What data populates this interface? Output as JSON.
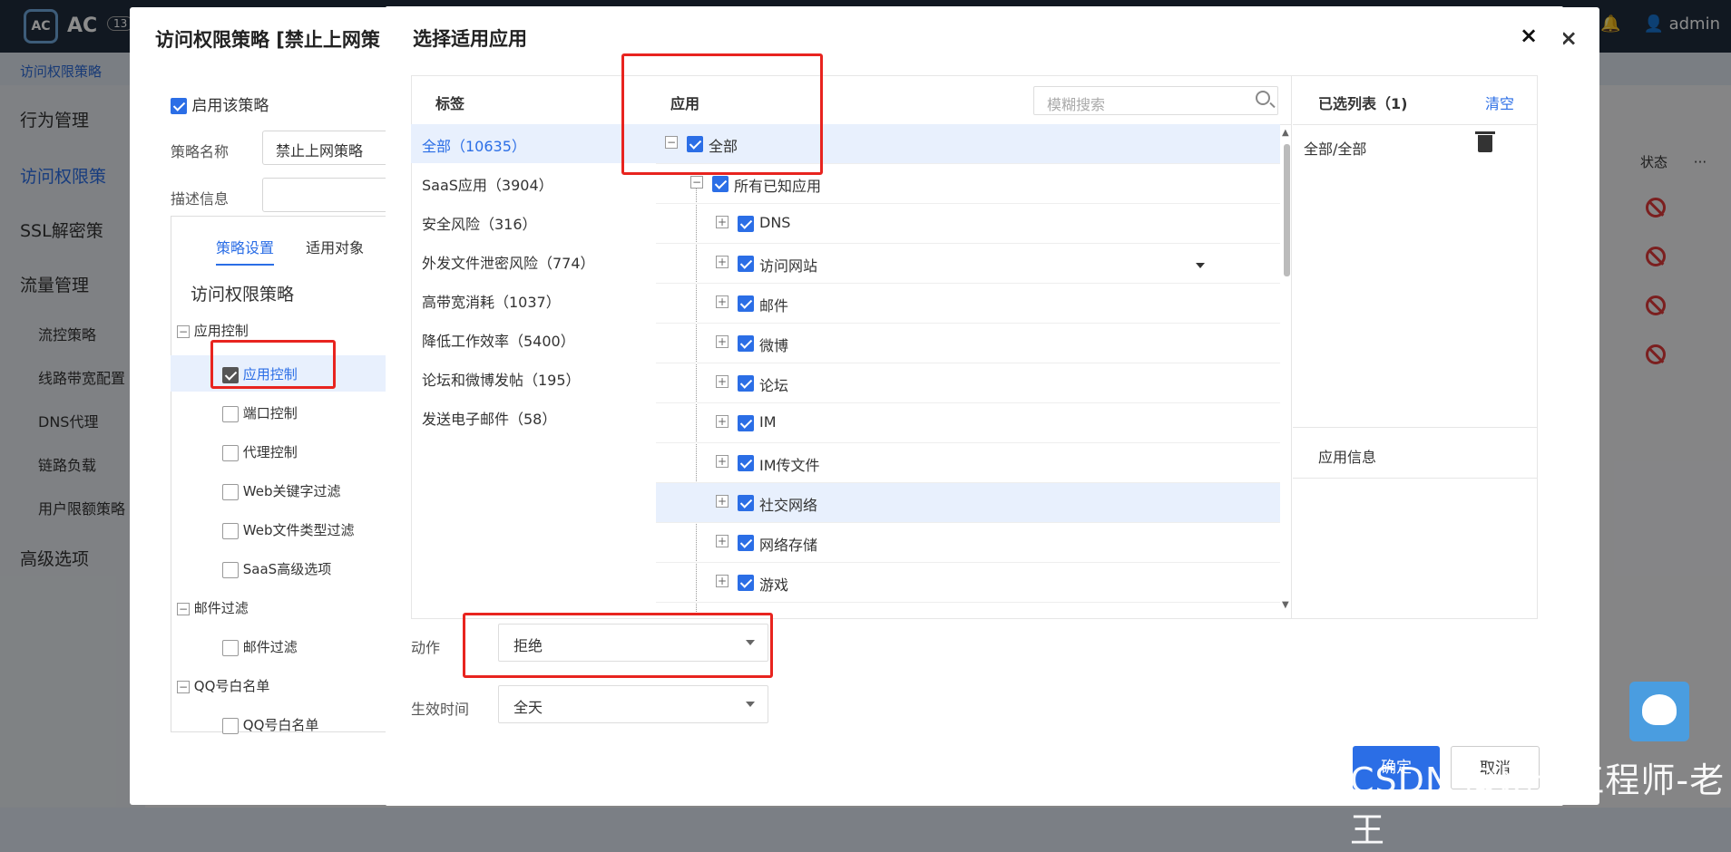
{
  "app": {
    "logo_text": "AC",
    "version_badge": "13",
    "user": "admin"
  },
  "breadcrumb": "访问权限策略",
  "sidenav": {
    "items": [
      "行为管理",
      "访问权限策",
      "SSL解密策",
      "流量管理",
      "高级选项"
    ],
    "subitems": [
      "流控策略",
      "线路带宽配置",
      "DNS代理",
      "链路负载",
      "用户限额策略"
    ]
  },
  "bg_table": {
    "status_header": "状态",
    "more": "···"
  },
  "policy_dialog": {
    "title": "访问权限策略 [禁止上网策",
    "enable_label": "启用该策略",
    "name_label": "策略名称",
    "name_value": "禁止上网策略",
    "desc_label": "描述信息",
    "tabs": [
      "策略设置",
      "适用对象"
    ],
    "section_title": "访问权限策略",
    "tree": [
      {
        "label": "应用控制",
        "group": true
      },
      {
        "label": "应用控制",
        "checked": true
      },
      {
        "label": "端口控制"
      },
      {
        "label": "代理控制"
      },
      {
        "label": "Web关键字过滤"
      },
      {
        "label": "Web文件类型过滤"
      },
      {
        "label": "SaaS高级选项"
      },
      {
        "label": "邮件过滤",
        "group": true
      },
      {
        "label": "邮件过滤"
      },
      {
        "label": "QQ号白名单",
        "group": true
      },
      {
        "label": "QQ号白名单"
      }
    ]
  },
  "app_dialog": {
    "title": "选择适用应用",
    "close": "×",
    "tag_header": "标签",
    "app_header": "应用",
    "search_placeholder": "模糊搜索",
    "tags": [
      "全部（10635）",
      "SaaS应用（3904）",
      "安全风险（316）",
      "外发文件泄密风险（774）",
      "高带宽消耗（1037）",
      "降低工作效率（5400）",
      "论坛和微博发帖（195）",
      "发送电子邮件（58）"
    ],
    "apps": [
      {
        "label": "全部",
        "level": 0
      },
      {
        "label": "所有已知应用",
        "level": 1
      },
      {
        "label": "DNS",
        "level": 2
      },
      {
        "label": "访问网站",
        "level": 2
      },
      {
        "label": "邮件",
        "level": 2
      },
      {
        "label": "微博",
        "level": 2
      },
      {
        "label": "论坛",
        "level": 2
      },
      {
        "label": "IM",
        "level": 2
      },
      {
        "label": "IM传文件",
        "level": 2
      },
      {
        "label": "社交网络",
        "level": 2
      },
      {
        "label": "网络存储",
        "level": 2
      },
      {
        "label": "游戏",
        "level": 2
      }
    ],
    "selected_header": "已选列表（1)",
    "clear": "清空",
    "selected_items": [
      "全部/全部"
    ],
    "app_info": "应用信息",
    "action_label": "动作",
    "action_value": "拒绝",
    "time_label": "生效时间",
    "time_value": "全天",
    "ok": "确定",
    "cancel": "取消"
  },
  "watermark": "CSDN @网云工程师-老王",
  "colors": {
    "accent": "#2b6ee6",
    "annotation_red": "#e8241f",
    "deny_red": "#e03a3a"
  }
}
